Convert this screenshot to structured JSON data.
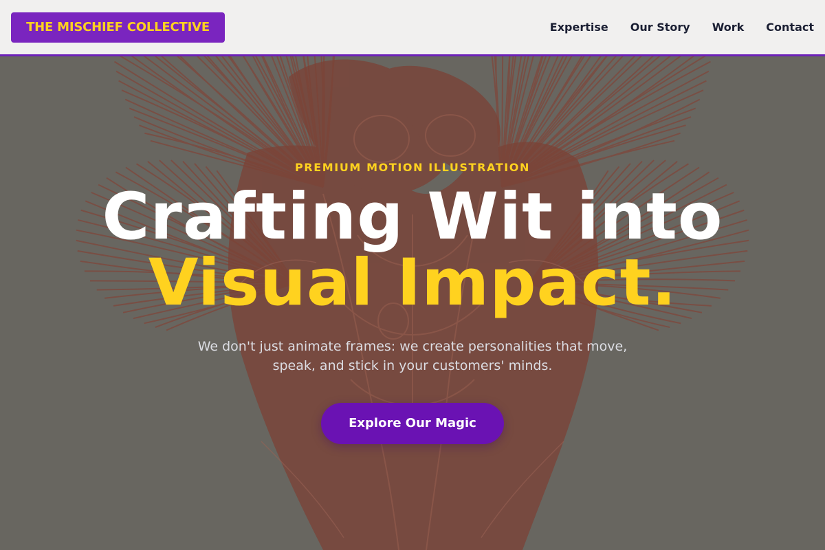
{
  "header": {
    "logo": "THE MISCHIEF COLLECTIVE",
    "nav": [
      "Expertise",
      "Our Story",
      "Work",
      "Contact"
    ]
  },
  "hero": {
    "eyebrow": "PREMIUM MOTION ILLUSTRATION",
    "headline_line1": "Crafting Wit into",
    "headline_line2": "Visual Impact.",
    "subtext_line1": "We don't just animate frames: we create personalities that move,",
    "subtext_line2": "speak, and stick in your customers' minds.",
    "cta_label": "Explore Our Magic",
    "background_illustration": "red-line-engraving-of-winged-figures"
  },
  "colors": {
    "brand_purple": "#7a25bf",
    "cta_purple": "#6a12b3",
    "accent_yellow": "#ffd21f",
    "nav_text": "#1b1f33",
    "illustration_red": "#8a3a2c"
  }
}
